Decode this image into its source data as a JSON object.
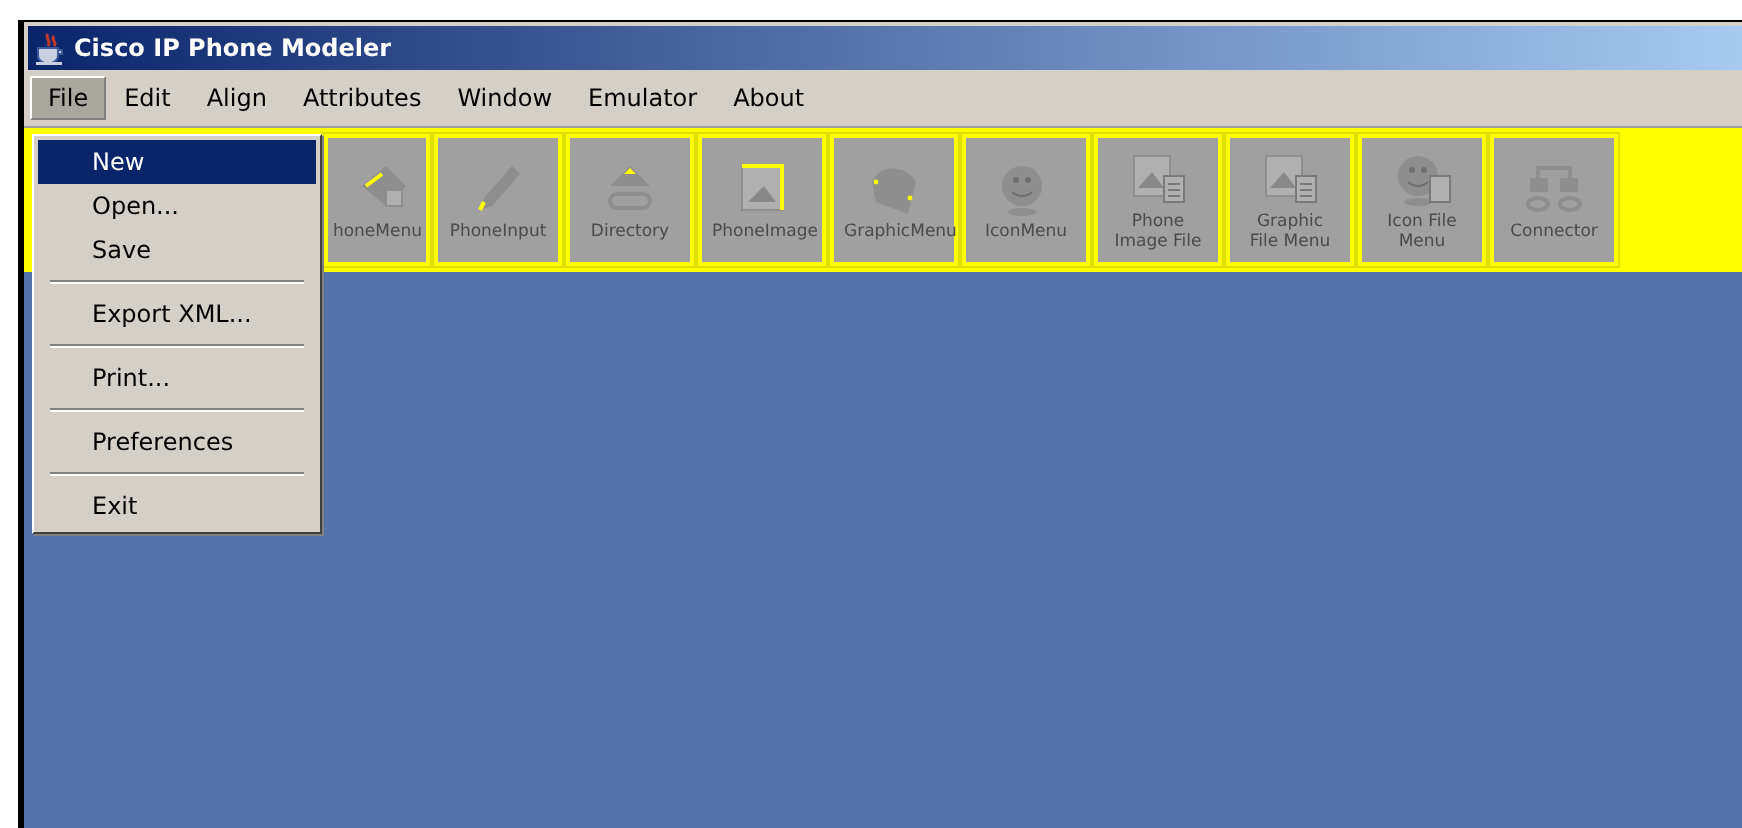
{
  "window": {
    "title": "Cisco IP Phone Modeler"
  },
  "menubar": [
    {
      "label": "File",
      "selected": true
    },
    {
      "label": "Edit",
      "selected": false
    },
    {
      "label": "Align",
      "selected": false
    },
    {
      "label": "Attributes",
      "selected": false
    },
    {
      "label": "Window",
      "selected": false
    },
    {
      "label": "Emulator",
      "selected": false
    },
    {
      "label": "About",
      "selected": false
    }
  ],
  "toolbar": [
    {
      "label": "honeMenu",
      "disabled": true
    },
    {
      "label": "PhoneInput",
      "disabled": true
    },
    {
      "label": "Directory",
      "disabled": true
    },
    {
      "label": "PhoneImage",
      "disabled": true
    },
    {
      "label": "GraphicMenu",
      "disabled": true
    },
    {
      "label": "IconMenu",
      "disabled": true
    },
    {
      "label": "Phone Image File",
      "disabled": true
    },
    {
      "label": "Graphic File Menu",
      "disabled": true
    },
    {
      "label": "Icon File Menu",
      "disabled": true
    },
    {
      "label": "Connector",
      "disabled": true
    }
  ],
  "file_menu": [
    {
      "label": "New",
      "selected": true,
      "separator_after": false
    },
    {
      "label": "Open...",
      "selected": false,
      "separator_after": false
    },
    {
      "label": "Save",
      "selected": false,
      "separator_after": true
    },
    {
      "label": "Export XML...",
      "selected": false,
      "separator_after": true
    },
    {
      "label": "Print...",
      "selected": false,
      "separator_after": true
    },
    {
      "label": "Preferences",
      "selected": false,
      "separator_after": true
    },
    {
      "label": "Exit",
      "selected": false,
      "separator_after": false
    }
  ]
}
